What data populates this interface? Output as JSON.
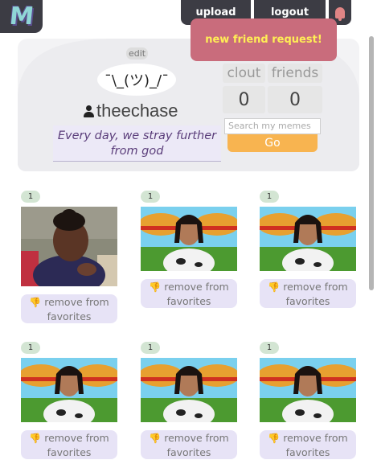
{
  "app": {
    "logo_letter": "M"
  },
  "topbar": {
    "upload_label": "upload",
    "logout_label": "logout",
    "bell_icon": "bell-icon"
  },
  "notification": {
    "text": "new friend request!"
  },
  "profile": {
    "edit_label": "edit",
    "avatar_text": "¯\\_(ツ)_/¯",
    "username": "theechase",
    "bio": "Every day, we stray further from god",
    "stats": {
      "clout_label": "clout",
      "clout_value": "0",
      "friends_label": "friends",
      "friends_value": "0"
    },
    "search": {
      "placeholder": "Search my memes",
      "go_label": "Go"
    }
  },
  "memes": [
    {
      "count": "1",
      "image": "side-eye-girl",
      "remove_label": "remove from favorites"
    },
    {
      "count": "1",
      "image": "burger-girl",
      "remove_label": "remove from favorites"
    },
    {
      "count": "1",
      "image": "burger-girl",
      "remove_label": "remove from favorites"
    },
    {
      "count": "1",
      "image": "burger-girl",
      "remove_label": "remove from favorites"
    },
    {
      "count": "1",
      "image": "burger-girl",
      "remove_label": "remove from favorites"
    },
    {
      "count": "1",
      "image": "burger-girl",
      "remove_label": "remove from favorites"
    }
  ],
  "colors": {
    "dark": "#3c3c44",
    "notification": "#c96c7c",
    "notification_text": "#ffee55",
    "go_button": "#f8b450",
    "remove_button": "#e7e3f6",
    "badge": "#d3e5d3"
  }
}
